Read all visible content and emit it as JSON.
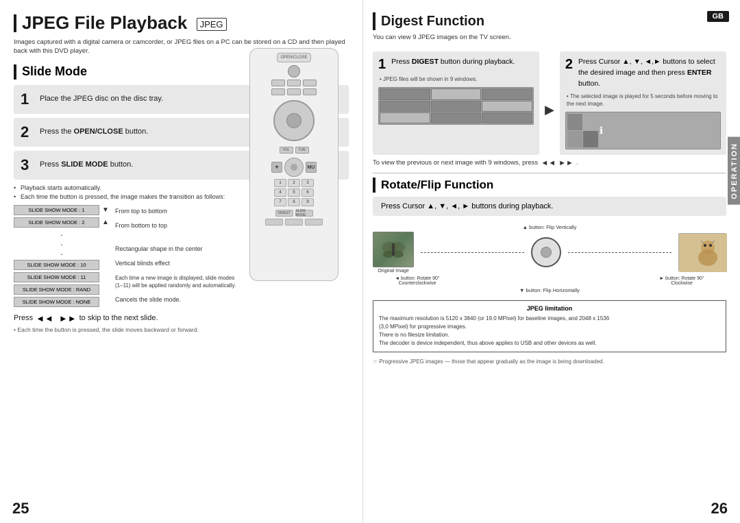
{
  "page": {
    "left_page": "25",
    "right_page": "26"
  },
  "left": {
    "main_title": "JPEG File Playback",
    "jpeg_tag": "JPEG",
    "subtitle": "Images captured with a digital camera or camcorder, or JPEG files on a PC can be stored on a CD and then\nplayed back with this DVD player.",
    "slide_mode_title": "Slide Mode",
    "steps": [
      {
        "num": "1",
        "text": "Place the JPEG disc on the disc tray."
      },
      {
        "num": "2",
        "text_before": "Press the ",
        "bold": "OPEN/CLOSE",
        "text_after": " button."
      },
      {
        "num": "3",
        "text_before": "Press ",
        "bold": "SLIDE MODE",
        "text_after": " button."
      }
    ],
    "bullets": [
      "Playback starts automatically.",
      "Each time the button is pressed, the image makes the transition as follows:"
    ],
    "slide_modes": [
      {
        "label": "SLIDE SHOW MODE : 1",
        "arrow": "▼",
        "desc": "From top to bottom"
      },
      {
        "label": "SLIDE SHOW MODE : 2",
        "arrow": "▲",
        "desc": "From bottom to top"
      },
      {
        "label": "SLIDE SHOW MODE : 10",
        "desc": "Rectangular shape in the center"
      },
      {
        "label": "SLIDE SHOW MODE : 11",
        "desc": "Vertical blinds effect"
      },
      {
        "label": "SLIDE SHOW MODE : RAND",
        "desc": "Each time a new image is displayed, slide modes\n(1–11) will be applied randomly and automatically."
      },
      {
        "label": "SLIDE SHOW MODE : NONE",
        "desc": "Cancels the slide mode."
      }
    ],
    "skip_prefix": "Press",
    "skip_buttons": "◄◄ ►► ◄◄ ►►",
    "skip_suffix": "to skip to the next slide.",
    "skip_note": "• Each time the button is pressed, the slide moves backward or forward."
  },
  "right": {
    "gb_badge": "GB",
    "digest_title": "Digest Function",
    "digest_subtitle": "You can view 9 JPEG images on the TV screen.",
    "step1_num": "1",
    "step1_bold": "DIGEST",
    "step1_prefix": "Press ",
    "step1_suffix": "button during playback.",
    "step1_note": "JPEG files will be shown in 9 windows.",
    "step2_num": "2",
    "step2_text": "Press Cursor ▲, ▼, ◄,► buttons to select the desired image and then press",
    "step2_bold": "ENTER",
    "step2_suffix": " button.",
    "step2_note": "The selected image is played for 5 seconds before moving to the next image.",
    "view_line": "To view the previous or next image with 9 windows, press◄◄ ►► .",
    "rotate_title": "Rotate/Flip Function",
    "rotate_step": "Press Cursor ▲, ▼, ◄, ► buttons during playback.",
    "rotate_labels": {
      "flip_vertically": "▲ button: Flip Vertically",
      "rotate_ccw": "◄ button: Rotate 90° Counterclockwise",
      "rotate_cw": "► button: Rotate 90° Clockwise",
      "flip_horizontally": "▼ button: Flip Horizontally",
      "original": "Original Image"
    },
    "limitation_title": "JPEG limitation",
    "limitation_lines": [
      "The maximum resolution is 5120 x 3840 (or 19.0 MPixel) for baseline images, and 2048 x 1536",
      "(3.0 MPixel) for progressive images.",
      "There is no filesize limitation.",
      "The decoder is device independent, thus above applies to USB and other devices as well."
    ],
    "limitation_note": "Progressive JPEG images — those that appear gradually as the image is being downloaded.",
    "operation_label": "OPERATION"
  }
}
